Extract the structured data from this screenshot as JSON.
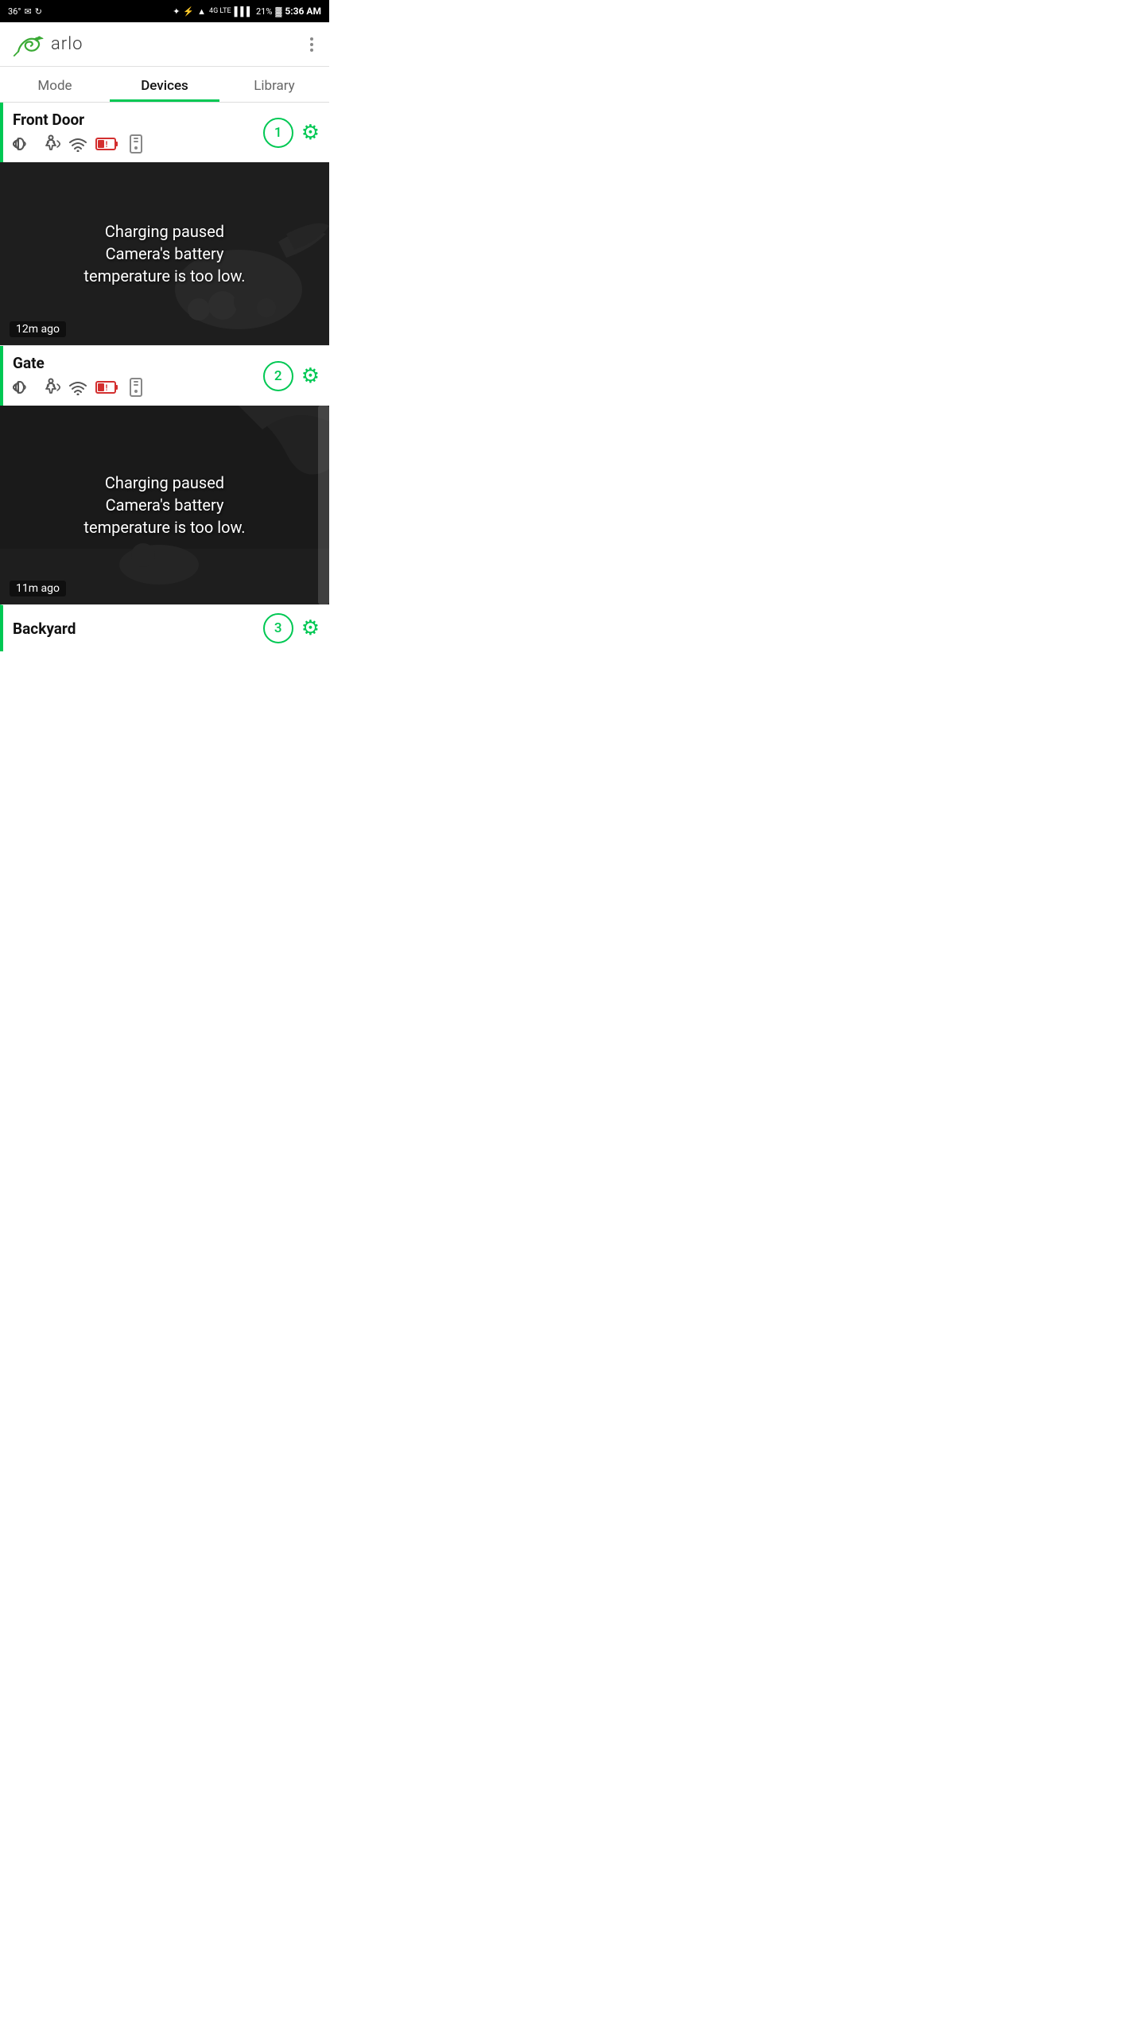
{
  "statusBar": {
    "temperature": "36°",
    "battery": "21%",
    "time": "5:36 AM",
    "network": "4G LTE"
  },
  "header": {
    "appName": "arlo",
    "moreLabel": "⋮"
  },
  "tabs": [
    {
      "id": "mode",
      "label": "Mode",
      "active": false
    },
    {
      "id": "devices",
      "label": "Devices",
      "active": true
    },
    {
      "id": "library",
      "label": "Library",
      "active": false
    }
  ],
  "devices": [
    {
      "id": "front-door",
      "name": "Front Door",
      "number": "1",
      "cameraMessage": "Charging paused\nCamera's battery\ntemperature is too low.",
      "timestamp": "12m ago"
    },
    {
      "id": "gate",
      "name": "Gate",
      "number": "2",
      "cameraMessage": "Charging paused\nCamera's battery\ntemperature is too low.",
      "timestamp": "11m ago"
    }
  ],
  "backyard": {
    "name": "Backyard"
  },
  "icons": {
    "sound": "🔊",
    "motion": "🚶",
    "wifi": "📶",
    "batteryLow": "🔋",
    "base": "📱",
    "gear": "⚙"
  }
}
